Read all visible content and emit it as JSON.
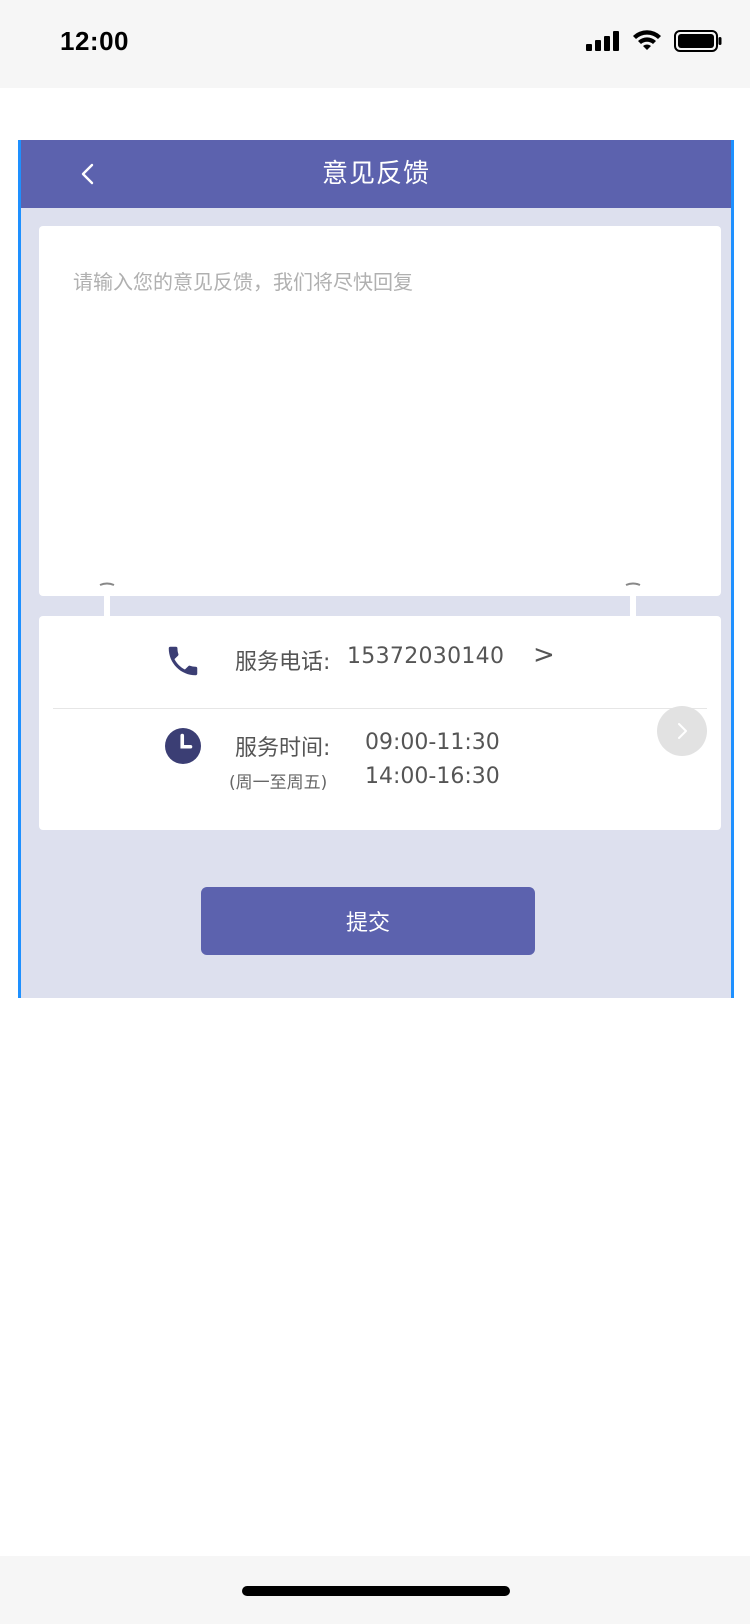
{
  "status_bar": {
    "time": "12:00",
    "signal_icon": "signal-bars-icon",
    "wifi_icon": "wifi-icon",
    "battery_icon": "battery-icon"
  },
  "nav": {
    "back_label": "<",
    "title": "意见反馈"
  },
  "feedback": {
    "placeholder": "请输入您的意见反馈，我们将尽快回复",
    "value": ""
  },
  "service_phone": {
    "icon": "phone-icon",
    "label": "服务电话:",
    "number": "15372030140",
    "chevron": ">"
  },
  "service_hours": {
    "icon": "clock-icon",
    "label": "服务时间:",
    "days": "(周一至周五)",
    "morning": "09:00-11:30",
    "afternoon": "14:00-16:30"
  },
  "submit": {
    "label": "提交"
  },
  "colors": {
    "primary": "#5c62ae",
    "background": "#dde0ee",
    "icon": "#3b3e74",
    "frame_border": "#1e90ff"
  }
}
